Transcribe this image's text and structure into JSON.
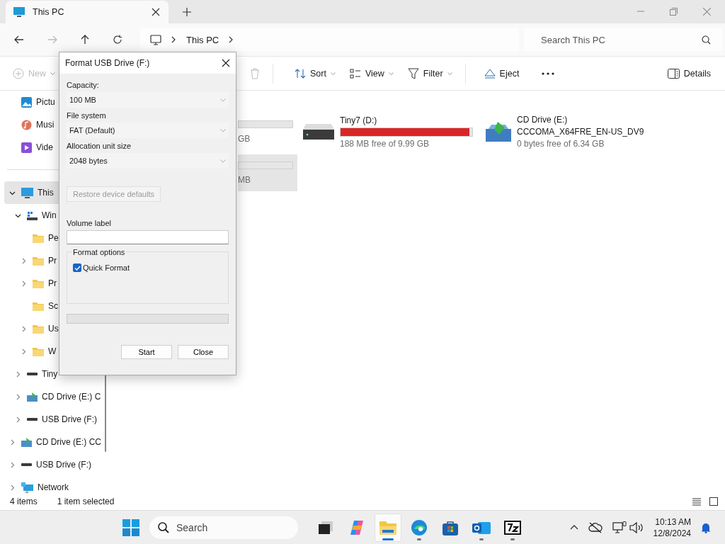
{
  "window": {
    "tabs": [
      {
        "title": "This PC",
        "selected": true
      }
    ]
  },
  "navigation": {
    "forward_disabled": true,
    "breadcrumb": [
      "This PC"
    ],
    "search": {
      "placeholder": "Search This PC"
    }
  },
  "toolbar": {
    "items": [
      {
        "kind": "new",
        "label": "New",
        "disabled": true
      },
      {
        "kind": "delete",
        "disabled": true
      },
      {
        "kind": "sort",
        "label": "Sort",
        "disabled": false
      },
      {
        "kind": "view",
        "label": "View",
        "disabled": false
      },
      {
        "kind": "filter",
        "label": "Filter",
        "disabled": false
      },
      {
        "kind": "eject",
        "label": "Eject",
        "disabled": false
      },
      {
        "kind": "more"
      }
    ],
    "details": "Details"
  },
  "sidebar": {
    "quick_access": [
      {
        "kind": "pictures",
        "label": "Pictu"
      },
      {
        "kind": "music",
        "label": "Musi"
      },
      {
        "kind": "videos",
        "label": "Vide"
      }
    ],
    "tree": [
      {
        "kind": "pc",
        "label": "This",
        "expandable": true,
        "expanded": true,
        "selected": true,
        "children": [
          {
            "kind": "system",
            "label": "Win",
            "expandable": true,
            "expanded": true,
            "selected": false,
            "children": [
              {
                "kind": "folder",
                "label": "Pe",
                "expandable": false,
                "selected": false
              },
              {
                "kind": "folder",
                "label": "Pr",
                "expandable": true,
                "expanded": false,
                "selected": false
              },
              {
                "kind": "folder",
                "label": "Pr",
                "expandable": true,
                "expanded": false,
                "selected": false
              },
              {
                "kind": "folder",
                "label": "Sc",
                "expandable": false,
                "selected": false
              },
              {
                "kind": "folder",
                "label": "Us",
                "expandable": true,
                "expanded": false,
                "selected": false
              },
              {
                "kind": "folder",
                "label": "W",
                "expandable": true,
                "expanded": false,
                "selected": false
              }
            ]
          },
          {
            "kind": "drive",
            "label": "Tiny",
            "expandable": true,
            "expanded": false,
            "selected": false
          },
          {
            "kind": "cd",
            "label": "CD Drive (E:) C",
            "expandable": true,
            "expanded": false,
            "selected": false
          },
          {
            "kind": "drive",
            "label": "USB Drive (F:)",
            "expandable": true,
            "expanded": false,
            "selected": false
          }
        ]
      },
      {
        "kind": "cd",
        "label": "CD Drive (E:) CC",
        "expandable": true,
        "expanded": false,
        "selected": false
      },
      {
        "kind": "drive",
        "label": "USB Drive (F:)",
        "expandable": true,
        "expanded": false,
        "selected": false
      },
      {
        "kind": "network",
        "label": "Network",
        "expandable": true,
        "expanded": false,
        "selected": false
      }
    ]
  },
  "drives": [
    {
      "kind": "partial",
      "free": "GB",
      "selected": false
    },
    {
      "kind": "drive",
      "name": "Tiny7 (D:)",
      "level": 0.98,
      "free": "188 MB free of 9.99 GB",
      "selected": false
    },
    {
      "kind": "cd",
      "name": "CD Drive (E:)",
      "volume": "CCCOMA_X64FRE_EN-US_DV9",
      "free": "0 bytes free of 6.34 GB",
      "selected": false
    },
    {
      "kind": "partial",
      "free": "MB",
      "selected": true
    }
  ],
  "status_bar": {
    "items": "4 items",
    "selection": "1 item selected"
  },
  "dialog": {
    "title": "Format USB Drive (F:)",
    "capacity_label": "Capacity:",
    "capacity": "100 MB",
    "file_system_label": "File system",
    "file_system": "FAT (Default)",
    "allocation_label": "Allocation unit size",
    "allocation": "2048 bytes",
    "restore_button": {
      "label": "Restore device defaults",
      "disabled": true
    },
    "volume_label_label": "Volume label",
    "format_options_title": "Format options",
    "quick_format": {
      "label": "Quick Format",
      "checked": true
    },
    "progress": {
      "level": 0
    },
    "buttons": [
      "Start",
      "Close"
    ]
  },
  "taskbar": {
    "search_placeholder": "Search",
    "apps": [
      {
        "kind": "desktop",
        "running": false,
        "active": false
      },
      {
        "kind": "copilot",
        "running": false,
        "active": false
      },
      {
        "kind": "explorer",
        "running": true,
        "active": true
      },
      {
        "kind": "edge",
        "running": true,
        "active": false
      },
      {
        "kind": "store",
        "running": false,
        "active": false
      },
      {
        "kind": "outlook",
        "running": true,
        "active": false
      },
      {
        "kind": "sevenzip",
        "running": true,
        "active": false
      }
    ],
    "time": "10:13 AM",
    "date": "12/8/2024"
  }
}
